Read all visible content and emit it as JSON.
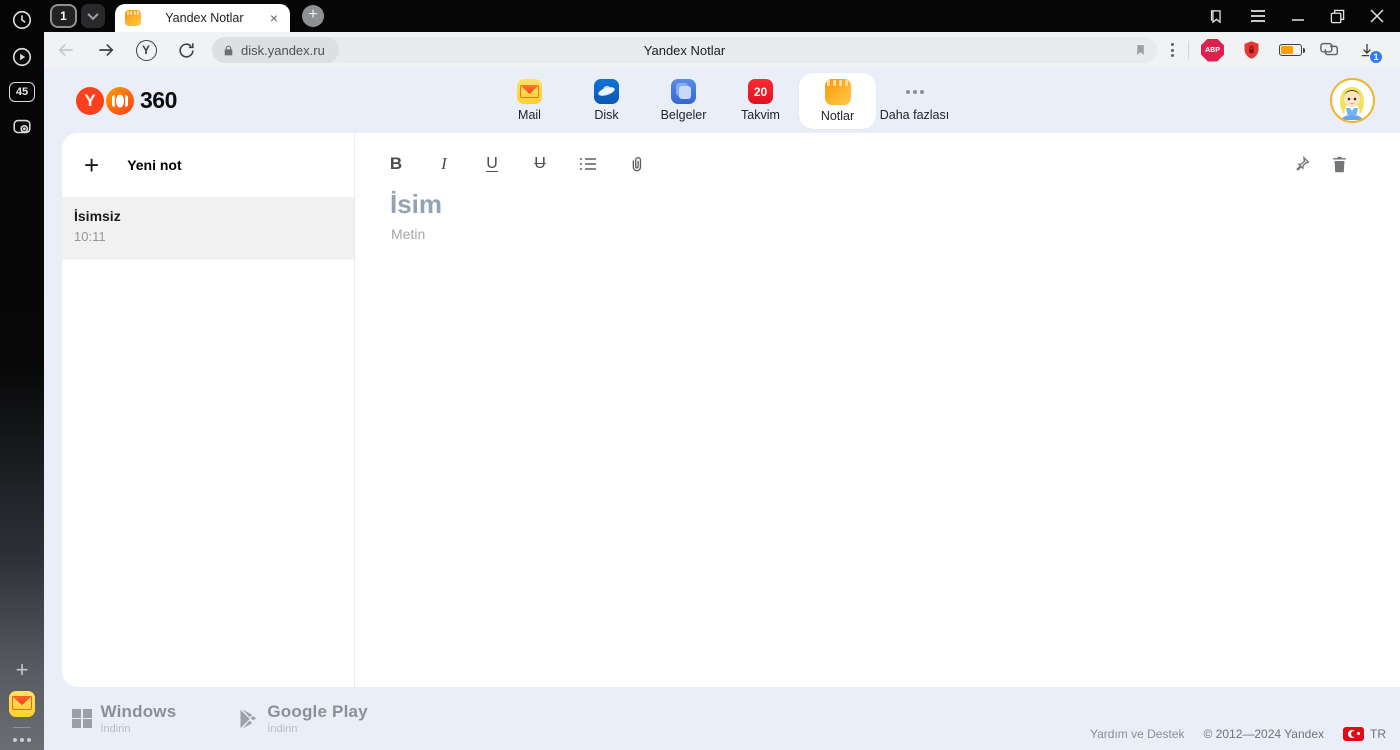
{
  "browser": {
    "tab_count": "1",
    "tab_title": "Yandex Notlar",
    "tab_close": "×",
    "new_tab": "+",
    "url": "disk.yandex.ru",
    "page_title": "Yandex Notlar",
    "abp_label": "ABP",
    "download_count": "1",
    "yandex_button_letter": "Y"
  },
  "left_rail": {
    "badge": "45",
    "plus": "+"
  },
  "header": {
    "logo_letter": "Y",
    "logo_text": "360",
    "apps": [
      {
        "label": "Mail"
      },
      {
        "label": "Disk"
      },
      {
        "label": "Belgeler"
      },
      {
        "label": "Takvim",
        "badge": "20"
      },
      {
        "label": "Notlar"
      },
      {
        "label": "Daha fazlası"
      }
    ]
  },
  "notes_panel": {
    "new_note_plus": "+",
    "new_note_label": "Yeni not",
    "items": [
      {
        "title": "İsimsiz",
        "time": "10:11"
      }
    ]
  },
  "editor": {
    "bold": "B",
    "italic": "I",
    "underline": "U",
    "strikethrough": "U",
    "title_placeholder": "İsim",
    "body_placeholder": "Metin"
  },
  "footer": {
    "windows": {
      "title": "Windows",
      "subtitle": "İndirin"
    },
    "google_play": {
      "title": "Google Play",
      "subtitle": "İndirin"
    },
    "help": "Yardım ve Destek",
    "copyright": "© 2012—2024 Yandex",
    "lang": "TR"
  },
  "colors": {
    "notes_accent": "#f59000",
    "yandex_red": "#fc3f1d",
    "page_bg": "#e9eef8",
    "calendar_red": "#e0121f",
    "download_badge": "#2f7cf6"
  }
}
